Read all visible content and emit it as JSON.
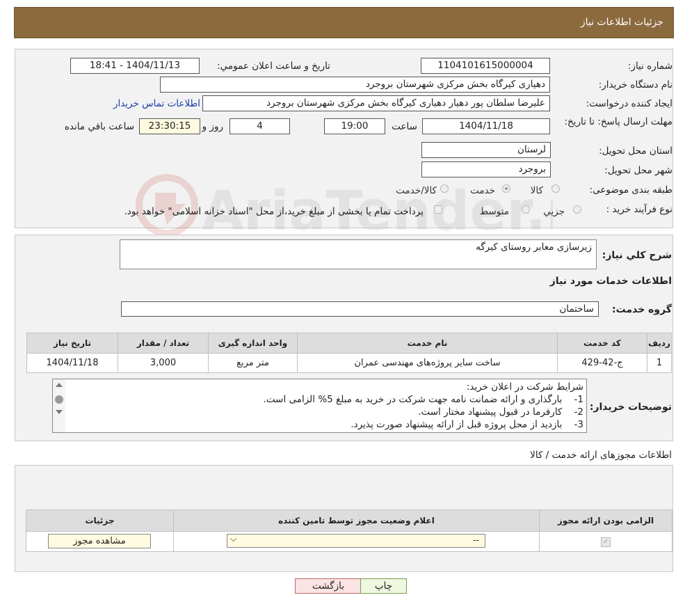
{
  "header": {
    "title": "جزئیات اطلاعات نیاز"
  },
  "watermark": {
    "text": "AriaTender.neT"
  },
  "form": {
    "need_number_label": "شماره نیاز:",
    "need_number": "1104101615000004",
    "announce_label": "تاریخ و ساعت اعلان عمومي:",
    "announce_value": "1404/11/13 - 18:41",
    "buyer_org_label": "نام دستگاه خريدار:",
    "buyer_org": "دهیاری کیرگاه بخش مرکزی شهرستان بروجرد",
    "creator_label": "ايجاد كننده درخواست:",
    "creator": "علیرضا سلطان پور دهیار دهیاری کیرگاه بخش مرکزی شهرستان بروجرد",
    "contact_link": "اطلاعات تماس خريدار",
    "deadline_label": "مهلت ارسال پاسخ: تا تاريخ:",
    "deadline_date": "1404/11/18",
    "time_label": "ساعت",
    "deadline_time": "19:00",
    "days_value": "4",
    "days_label": "روز و",
    "remaining_time": "23:30:15",
    "remaining_label": "ساعت باقي مانده",
    "province_label": "استان محل تحويل:",
    "province": "لرستان",
    "city_label": "شهر محل تحويل:",
    "city": "بروجرد",
    "category_label": "طبقه بندی موضوعی:",
    "category_options": [
      "كالا",
      "خدمت",
      "كالا/خدمت"
    ],
    "category_selected": "خدمت",
    "process_label": "نوع فرآيند خريد :",
    "process_options": [
      "جزيي",
      "متوسط"
    ],
    "process_note": "پرداخت تمام یا بخشی از مبلغ خرید،از محل \"اسناد خزانه اسلامی\" خواهد بود."
  },
  "details": {
    "summary_label": "شرح كلي نياز:",
    "summary": "زیرسازی معابر روستای کیرگه",
    "services_title": "اطلاعات خدمات مورد نياز",
    "group_label": "گروه خدمت:",
    "group_value": "ساختمان",
    "table": {
      "headers": [
        "رديف",
        "كد خدمت",
        "نام خدمت",
        "واحد اندازه گيری",
        "تعداد / مقدار",
        "تاريخ نياز"
      ],
      "rows": [
        [
          "1",
          "ج-42-429",
          "ساخت سایر پروژه‌های مهندسی عمران",
          "متر مربع",
          "3,000",
          "1404/11/18"
        ]
      ]
    },
    "buyer_notes_label": "توضيحات خريدار:",
    "buyer_notes": [
      "شرایط شرکت در اعلان خرید:",
      "1-    بارگذاری و ارائه ضمانت نامه جهت شرکت در خرید به مبلغ 5% الزامی است.",
      "2-    کارفرما در قبول پیشنهاد مختار است.",
      "3-    بازدید از محل پروژه قبل از ارائه پیشنهاد صورت پذیرد."
    ]
  },
  "permits": {
    "title": "اطلاعات مجوزهای ارائه خدمت / كالا",
    "headers": [
      "الزامی بودن ارائه مجوز",
      "اعلام وضعيت مجوز توسط تامين كننده",
      "جزئيات"
    ],
    "select_value": "--",
    "view_button": "مشاهده مجوز"
  },
  "actions": {
    "print": "چاپ",
    "back": "بازگشت"
  }
}
